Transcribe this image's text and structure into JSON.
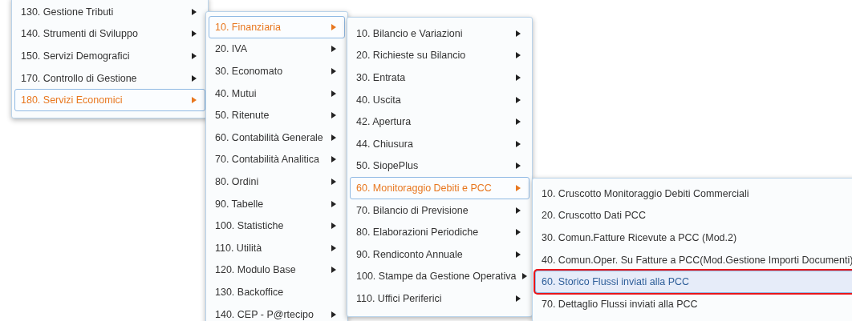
{
  "menus": [
    {
      "items": [
        {
          "label": "130. Gestione Tributi",
          "submenu": true,
          "selected": false
        },
        {
          "label": "140. Strumenti di Sviluppo",
          "submenu": true,
          "selected": false
        },
        {
          "label": "150. Servizi Demografici",
          "submenu": true,
          "selected": false
        },
        {
          "label": "170. Controllo di Gestione",
          "submenu": true,
          "selected": false
        },
        {
          "label": "180. Servizi Economici",
          "submenu": true,
          "selected": true
        }
      ]
    },
    {
      "items": [
        {
          "label": "10. Finanziaria",
          "submenu": true,
          "selected": true
        },
        {
          "label": "20. IVA",
          "submenu": true,
          "selected": false
        },
        {
          "label": "30. Economato",
          "submenu": true,
          "selected": false
        },
        {
          "label": "40. Mutui",
          "submenu": true,
          "selected": false
        },
        {
          "label": "50. Ritenute",
          "submenu": true,
          "selected": false
        },
        {
          "label": "60. Contabilità Generale",
          "submenu": true,
          "selected": false
        },
        {
          "label": "70. Contabilità Analitica",
          "submenu": true,
          "selected": false
        },
        {
          "label": "80. Ordini",
          "submenu": true,
          "selected": false
        },
        {
          "label": "90. Tabelle",
          "submenu": true,
          "selected": false
        },
        {
          "label": "100. Statistiche",
          "submenu": true,
          "selected": false
        },
        {
          "label": "110. Utilità",
          "submenu": true,
          "selected": false
        },
        {
          "label": "120. Modulo Base",
          "submenu": true,
          "selected": false
        },
        {
          "label": "130. Backoffice",
          "submenu": false,
          "selected": false
        },
        {
          "label": "140. CEP - P@rtecipo",
          "submenu": true,
          "selected": false
        }
      ]
    },
    {
      "items": [
        {
          "label": "10. Bilancio e Variazioni",
          "submenu": true,
          "selected": false
        },
        {
          "label": "20. Richieste su Bilancio",
          "submenu": true,
          "selected": false
        },
        {
          "label": "30. Entrata",
          "submenu": true,
          "selected": false
        },
        {
          "label": "40. Uscita",
          "submenu": true,
          "selected": false
        },
        {
          "label": "42. Apertura",
          "submenu": true,
          "selected": false
        },
        {
          "label": "44. Chiusura",
          "submenu": true,
          "selected": false
        },
        {
          "label": "50. SiopePlus",
          "submenu": true,
          "selected": false
        },
        {
          "label": "60. Monitoraggio Debiti e PCC",
          "submenu": true,
          "selected": true
        },
        {
          "label": "70. Bilancio di Previsione",
          "submenu": true,
          "selected": false
        },
        {
          "label": "80. Elaborazioni Periodiche",
          "submenu": true,
          "selected": false
        },
        {
          "label": "90. Rendiconto Annuale",
          "submenu": true,
          "selected": false
        },
        {
          "label": "100. Stampe da Gestione Operativa",
          "submenu": true,
          "selected": false
        },
        {
          "label": "110. Uffici Periferici",
          "submenu": true,
          "selected": false
        }
      ]
    },
    {
      "items": [
        {
          "label": "10. Cruscotto Monitoraggio Debiti Commerciali",
          "submenu": false,
          "highlighted": false
        },
        {
          "label": "20. Cruscotto Dati PCC",
          "submenu": false,
          "highlighted": false
        },
        {
          "label": "30. Comun.Fatture Ricevute a PCC (Mod.2)",
          "submenu": false,
          "highlighted": false
        },
        {
          "label": "40. Comun.Oper. Su Fatture a PCC(Mod.Gestione Importi Documenti)",
          "submenu": false,
          "highlighted": false
        },
        {
          "label": "60. Storico Flussi inviati alla PCC",
          "submenu": false,
          "highlighted": true
        },
        {
          "label": "70. Dettaglio Flussi inviati alla PCC",
          "submenu": false,
          "highlighted": false
        }
      ]
    }
  ]
}
